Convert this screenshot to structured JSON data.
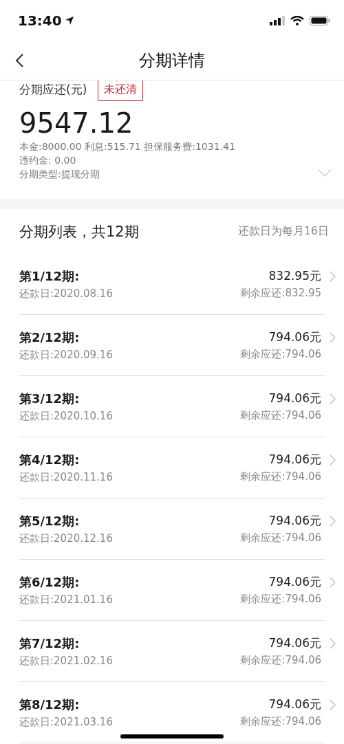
{
  "status_bar": {
    "time": "13:40"
  },
  "nav": {
    "title": "分期详情"
  },
  "summary": {
    "label": "分期应还(元)",
    "badge": "未还清",
    "amount": "9547.12",
    "details": [
      "本金:8000.00 利息:515.71 担保服务费:1031.41",
      "违约金: 0.00",
      "分期类型:提现分期"
    ],
    "expanded": false
  },
  "list": {
    "title": "分期列表，共12期",
    "note": "还款日为每月16日",
    "rows": [
      {
        "period": "第1/12期:",
        "date": "还款日:2020.08.16",
        "amount": "832.95元",
        "remaining": "剩余应还:832.95"
      },
      {
        "period": "第2/12期:",
        "date": "还款日:2020.09.16",
        "amount": "794.06元",
        "remaining": "剩余应还:794.06"
      },
      {
        "period": "第3/12期:",
        "date": "还款日:2020.10.16",
        "amount": "794.06元",
        "remaining": "剩余应还:794.06"
      },
      {
        "period": "第4/12期:",
        "date": "还款日:2020.11.16",
        "amount": "794.06元",
        "remaining": "剩余应还:794.06"
      },
      {
        "period": "第5/12期:",
        "date": "还款日:2020.12.16",
        "amount": "794.06元",
        "remaining": "剩余应还:794.06"
      },
      {
        "period": "第6/12期:",
        "date": "还款日:2021.01.16",
        "amount": "794.06元",
        "remaining": "剩余应还:794.06"
      },
      {
        "period": "第7/12期:",
        "date": "还款日:2021.02.16",
        "amount": "794.06元",
        "remaining": "剩余应还:794.06"
      },
      {
        "period": "第8/12期:",
        "date": "还款日:2021.03.16",
        "amount": "794.06元",
        "remaining": "剩余应还:794.06"
      }
    ]
  }
}
